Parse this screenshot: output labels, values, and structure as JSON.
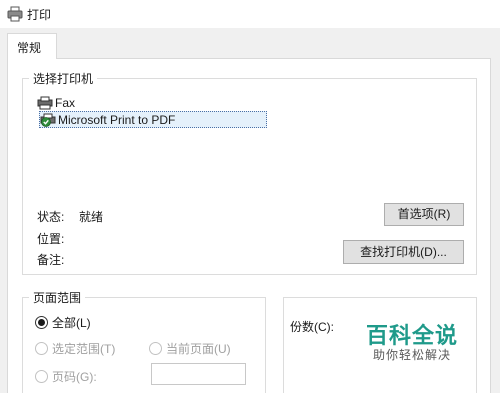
{
  "window": {
    "title": "打印",
    "icon": "printer-icon"
  },
  "tabs": [
    {
      "label": "常规",
      "active": true
    }
  ],
  "select_printer": {
    "legend": "选择打印机",
    "printers": [
      {
        "name": "Fax",
        "icon": "fax-printer-icon",
        "selected": false
      },
      {
        "name": "Microsoft Print to PDF",
        "icon": "default-printer-icon",
        "selected": true
      }
    ],
    "status_label": "状态:",
    "status_value": "就绪",
    "location_label": "位置:",
    "comment_label": "备注:",
    "preferences_button": "首选项(R)",
    "find_printer_button": "查找打印机(D)..."
  },
  "page_range": {
    "legend": "页面范围",
    "all": "全部(L)",
    "selection": "选定范围(T)",
    "current_page": "当前页面(U)",
    "pages": "页码(G):",
    "pages_value": ""
  },
  "copies": {
    "label": "份数(C):"
  },
  "watermark": {
    "main": "百科全说",
    "sub": "助你轻松解决"
  },
  "colors": {
    "accent": "#1f9a8a",
    "selection_bg": "#e5f1fb",
    "dialog_bg": "#f0f0f0"
  }
}
